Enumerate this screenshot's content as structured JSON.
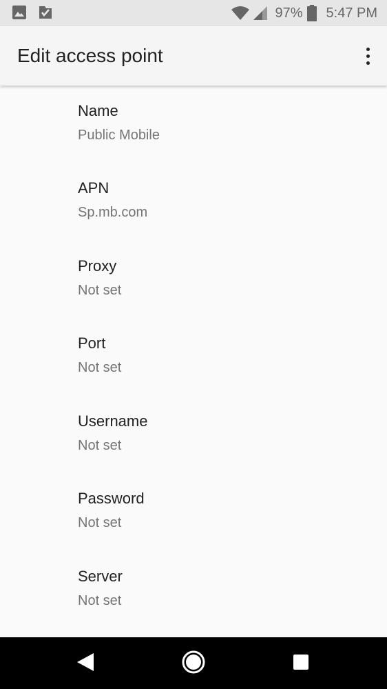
{
  "status_bar": {
    "battery_percent": "97%",
    "time": "5:47 PM",
    "icons": [
      "image-icon",
      "play-store-icon",
      "wifi-icon",
      "signal-icon",
      "battery-icon"
    ]
  },
  "app_bar": {
    "title": "Edit access point",
    "overflow_icon": "more-vert-icon"
  },
  "preferences": [
    {
      "title": "Name",
      "summary": "Public Mobile"
    },
    {
      "title": "APN",
      "summary": "Sp.mb.com"
    },
    {
      "title": "Proxy",
      "summary": "Not set"
    },
    {
      "title": "Port",
      "summary": "Not set"
    },
    {
      "title": "Username",
      "summary": "Not set"
    },
    {
      "title": "Password",
      "summary": "Not set"
    },
    {
      "title": "Server",
      "summary": "Not set"
    }
  ],
  "nav_bar": {
    "icons": [
      "back-icon",
      "home-icon",
      "recents-icon"
    ]
  },
  "colors": {
    "status_bar_bg": "#e6e6e6",
    "app_bar_bg": "#f5f5f5",
    "content_bg": "#fafafa",
    "title_text": "#212121",
    "summary_text": "#757575",
    "nav_bar_bg": "#000000"
  }
}
